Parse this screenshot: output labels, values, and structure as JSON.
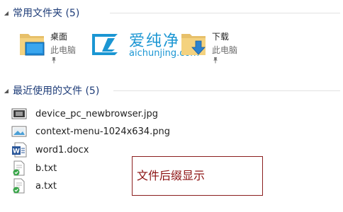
{
  "frequent_folders": {
    "title": "常用文件夹 (5)",
    "tiles": [
      {
        "name": "桌面",
        "location": "此电脑",
        "icon": "desktop-folder-icon"
      },
      {
        "name": "下载",
        "location": "此电脑",
        "icon": "downloads-folder-icon"
      }
    ]
  },
  "recent_files": {
    "title": "最近使用的文件 (5)",
    "items": [
      {
        "name": "device_pc_newbrowser.jpg",
        "icon": "image-file-icon"
      },
      {
        "name": "context-menu-1024x634.png",
        "icon": "image-file-icon"
      },
      {
        "name": "word1.docx",
        "icon": "word-document-icon"
      },
      {
        "name": "b.txt",
        "icon": "text-file-icon"
      },
      {
        "name": "a.txt",
        "icon": "text-file-icon"
      }
    ]
  },
  "watermark": {
    "brand": "爱纯净",
    "url": "aichunjing.com"
  },
  "callout": {
    "text": "文件后缀显示"
  },
  "colors": {
    "section_title": "#1e3c78",
    "watermark": "#1b96d3",
    "callout_border": "#8b1f1f",
    "callout_text": "#8b1010"
  }
}
